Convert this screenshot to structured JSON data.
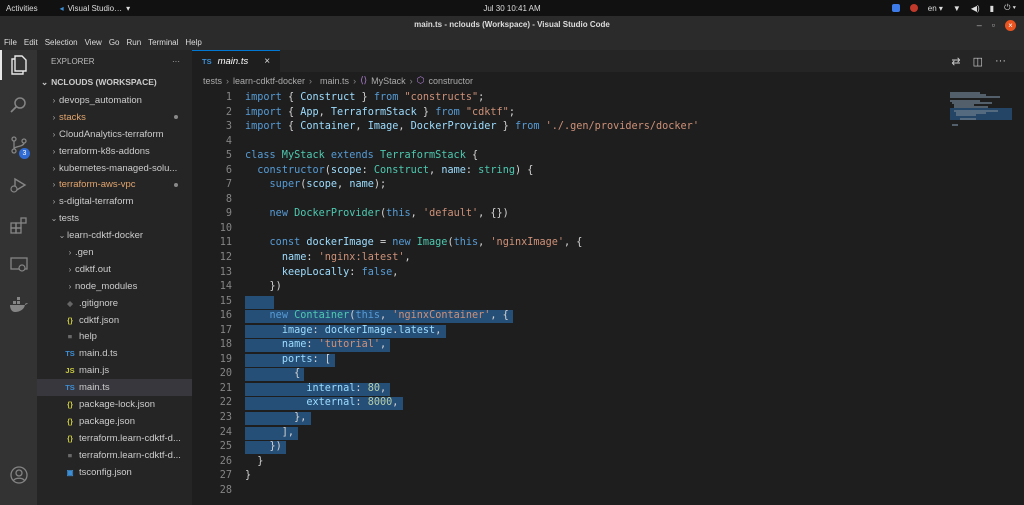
{
  "system_bar": {
    "activities": "Activities",
    "app_name": "Visual Studio…",
    "clock": "Jul 30  10:41 AM",
    "lang": "en"
  },
  "window": {
    "title": "main.ts - nclouds (Workspace) - Visual Studio Code"
  },
  "menu": {
    "items": [
      "File",
      "Edit",
      "Selection",
      "View",
      "Go",
      "Run",
      "Terminal",
      "Help"
    ]
  },
  "activity_bar": {
    "scm_badge": "3"
  },
  "sidebar": {
    "title": "EXPLORER",
    "more": "···",
    "workspace": "NCLOUDS (WORKSPACE)",
    "items": [
      {
        "label": "devops_automation",
        "chevron": "›",
        "icon": "",
        "indent": 12,
        "color": "#cccccc",
        "modified": false
      },
      {
        "label": "stacks",
        "chevron": "›",
        "icon": "",
        "indent": 12,
        "color": "#e2a56d",
        "modified": true
      },
      {
        "label": "CloudAnalytics-terraform",
        "chevron": "›",
        "icon": "",
        "indent": 12,
        "color": "#cccccc",
        "modified": false
      },
      {
        "label": "terraform-k8s-addons",
        "chevron": "›",
        "icon": "",
        "indent": 12,
        "color": "#cccccc",
        "modified": false
      },
      {
        "label": "kubernetes-managed-solu...",
        "chevron": "›",
        "icon": "",
        "indent": 12,
        "color": "#cccccc",
        "modified": false
      },
      {
        "label": "terraform-aws-vpc",
        "chevron": "›",
        "icon": "",
        "indent": 12,
        "color": "#e2a56d",
        "modified": true
      },
      {
        "label": "s-digital-terraform",
        "chevron": "›",
        "icon": "",
        "indent": 12,
        "color": "#cccccc",
        "modified": false
      },
      {
        "label": "tests",
        "chevron": "⌄",
        "icon": "",
        "indent": 12,
        "color": "#cccccc",
        "modified": false
      },
      {
        "label": "learn-cdktf-docker",
        "chevron": "⌄",
        "icon": "",
        "indent": 20,
        "color": "#cccccc",
        "modified": false
      },
      {
        "label": ".gen",
        "chevron": "›",
        "icon": "",
        "indent": 28,
        "color": "#cccccc",
        "modified": false
      },
      {
        "label": "cdktf.out",
        "chevron": "›",
        "icon": "",
        "indent": 28,
        "color": "#cccccc",
        "modified": false
      },
      {
        "label": "node_modules",
        "chevron": "›",
        "icon": "",
        "indent": 28,
        "color": "#cccccc",
        "modified": false
      },
      {
        "label": ".gitignore",
        "chevron": "",
        "icon": "◆",
        "icon_color": "#666666",
        "indent": 28,
        "color": "#cccccc",
        "modified": false
      },
      {
        "label": "cdktf.json",
        "chevron": "",
        "icon": "{}",
        "icon_color": "#cbcb41",
        "indent": 28,
        "color": "#cccccc",
        "modified": false
      },
      {
        "label": "help",
        "chevron": "",
        "icon": "≡",
        "icon_color": "#aaaaaa",
        "indent": 28,
        "color": "#cccccc",
        "modified": false
      },
      {
        "label": "main.d.ts",
        "chevron": "",
        "icon": "TS",
        "icon_color": "#3c8fd6",
        "indent": 28,
        "color": "#cccccc",
        "modified": false
      },
      {
        "label": "main.js",
        "chevron": "",
        "icon": "JS",
        "icon_color": "#cbcb41",
        "indent": 28,
        "color": "#cccccc",
        "modified": false
      },
      {
        "label": "main.ts",
        "chevron": "",
        "icon": "TS",
        "icon_color": "#3c8fd6",
        "indent": 28,
        "color": "#cccccc",
        "modified": false,
        "selected": true
      },
      {
        "label": "package-lock.json",
        "chevron": "",
        "icon": "{}",
        "icon_color": "#cbcb41",
        "indent": 28,
        "color": "#cccccc",
        "modified": false
      },
      {
        "label": "package.json",
        "chevron": "",
        "icon": "{}",
        "icon_color": "#cbcb41",
        "indent": 28,
        "color": "#cccccc",
        "modified": false
      },
      {
        "label": "terraform.learn-cdktf-d...",
        "chevron": "",
        "icon": "{}",
        "icon_color": "#cbcb41",
        "indent": 28,
        "color": "#cccccc",
        "modified": false
      },
      {
        "label": "terraform.learn-cdktf-d...",
        "chevron": "",
        "icon": "≡",
        "icon_color": "#aaaaaa",
        "indent": 28,
        "color": "#cccccc",
        "modified": false
      },
      {
        "label": "tsconfig.json",
        "chevron": "",
        "icon": "▣",
        "icon_color": "#3c8fd6",
        "indent": 28,
        "color": "#cccccc",
        "modified": false
      }
    ]
  },
  "editor": {
    "tab": {
      "icon": "TS",
      "label": "main.ts",
      "close": "×"
    },
    "breadcrumb": [
      "tests",
      "learn-cdktf-docker",
      "main.ts",
      "MyStack",
      "constructor"
    ],
    "breadcrumb_icons": {
      "main.ts": "TS",
      "MyStack": "⟨⟩",
      "constructor": "⬡"
    },
    "lines": [
      {
        "n": 1,
        "code": [
          [
            "k",
            "import"
          ],
          [
            "p",
            " { "
          ],
          [
            "v",
            "Construct"
          ],
          [
            "p",
            " } "
          ],
          [
            "k",
            "from"
          ],
          [
            "s",
            " \"constructs\""
          ],
          [
            "p",
            ";"
          ]
        ]
      },
      {
        "n": 2,
        "code": [
          [
            "k",
            "import"
          ],
          [
            "p",
            " { "
          ],
          [
            "v",
            "App"
          ],
          [
            "p",
            ", "
          ],
          [
            "v",
            "TerraformStack"
          ],
          [
            "p",
            " } "
          ],
          [
            "k",
            "from"
          ],
          [
            "s",
            " \"cdktf\""
          ],
          [
            "p",
            ";"
          ]
        ]
      },
      {
        "n": 3,
        "code": [
          [
            "k",
            "import"
          ],
          [
            "p",
            " { "
          ],
          [
            "v",
            "Container"
          ],
          [
            "p",
            ", "
          ],
          [
            "v",
            "Image"
          ],
          [
            "p",
            ", "
          ],
          [
            "v",
            "DockerProvider"
          ],
          [
            "p",
            " } "
          ],
          [
            "k",
            "from"
          ],
          [
            "s",
            " './.gen/providers/docker'"
          ]
        ]
      },
      {
        "n": 4,
        "code": []
      },
      {
        "n": 5,
        "code": [
          [
            "k",
            "class"
          ],
          [
            "t",
            " MyStack"
          ],
          [
            "k",
            " extends"
          ],
          [
            "t",
            " TerraformStack"
          ],
          [
            "p",
            " {"
          ]
        ]
      },
      {
        "n": 6,
        "code": [
          [
            "p",
            "  "
          ],
          [
            "k",
            "constructor"
          ],
          [
            "p",
            "("
          ],
          [
            "v",
            "scope"
          ],
          [
            "p",
            ": "
          ],
          [
            "t",
            "Construct"
          ],
          [
            "p",
            ", "
          ],
          [
            "v",
            "name"
          ],
          [
            "p",
            ": "
          ],
          [
            "t",
            "string"
          ],
          [
            "p",
            ") {"
          ]
        ]
      },
      {
        "n": 7,
        "code": [
          [
            "p",
            "    "
          ],
          [
            "k",
            "super"
          ],
          [
            "p",
            "("
          ],
          [
            "v",
            "scope"
          ],
          [
            "p",
            ", "
          ],
          [
            "v",
            "name"
          ],
          [
            "p",
            ");"
          ]
        ]
      },
      {
        "n": 8,
        "code": []
      },
      {
        "n": 9,
        "code": [
          [
            "p",
            "    "
          ],
          [
            "k",
            "new"
          ],
          [
            "t",
            " DockerProvider"
          ],
          [
            "p",
            "("
          ],
          [
            "k",
            "this"
          ],
          [
            "p",
            ", "
          ],
          [
            "s",
            "'default'"
          ],
          [
            "p",
            ", {})"
          ]
        ]
      },
      {
        "n": 10,
        "code": []
      },
      {
        "n": 11,
        "code": [
          [
            "p",
            "    "
          ],
          [
            "k",
            "const"
          ],
          [
            "v",
            " dockerImage"
          ],
          [
            "p",
            " = "
          ],
          [
            "k",
            "new"
          ],
          [
            "t",
            " Image"
          ],
          [
            "p",
            "("
          ],
          [
            "k",
            "this"
          ],
          [
            "p",
            ", "
          ],
          [
            "s",
            "'nginxImage'"
          ],
          [
            "p",
            ", {"
          ]
        ]
      },
      {
        "n": 12,
        "code": [
          [
            "p",
            "      "
          ],
          [
            "v",
            "name"
          ],
          [
            "p",
            ": "
          ],
          [
            "s",
            "'nginx:latest'"
          ],
          [
            "p",
            ","
          ]
        ]
      },
      {
        "n": 13,
        "code": [
          [
            "p",
            "      "
          ],
          [
            "v",
            "keepLocally"
          ],
          [
            "p",
            ": "
          ],
          [
            "k",
            "false"
          ],
          [
            "p",
            ","
          ]
        ]
      },
      {
        "n": 14,
        "code": [
          [
            "p",
            "    })"
          ]
        ]
      },
      {
        "n": 15,
        "code": [
          [
            "p",
            "    "
          ]
        ],
        "sel": true
      },
      {
        "n": 16,
        "code": [
          [
            "p",
            "    "
          ],
          [
            "k",
            "new"
          ],
          [
            "t",
            " Container"
          ],
          [
            "p",
            "("
          ],
          [
            "k",
            "this"
          ],
          [
            "p",
            ", "
          ],
          [
            "s",
            "'nginxContainer'"
          ],
          [
            "p",
            ", {"
          ]
        ],
        "sel": true
      },
      {
        "n": 17,
        "code": [
          [
            "p",
            "      "
          ],
          [
            "v",
            "image"
          ],
          [
            "p",
            ": "
          ],
          [
            "v",
            "dockerImage"
          ],
          [
            "p",
            "."
          ],
          [
            "v",
            "latest"
          ],
          [
            "p",
            ","
          ]
        ],
        "sel": true
      },
      {
        "n": 18,
        "code": [
          [
            "p",
            "      "
          ],
          [
            "v",
            "name"
          ],
          [
            "p",
            ": "
          ],
          [
            "s",
            "'tutorial'"
          ],
          [
            "p",
            ","
          ]
        ],
        "sel": true
      },
      {
        "n": 19,
        "code": [
          [
            "p",
            "      "
          ],
          [
            "v",
            "ports"
          ],
          [
            "p",
            ": ["
          ]
        ],
        "sel": true
      },
      {
        "n": 20,
        "code": [
          [
            "p",
            "        {"
          ]
        ],
        "sel": true
      },
      {
        "n": 21,
        "code": [
          [
            "p",
            "          "
          ],
          [
            "v",
            "internal"
          ],
          [
            "p",
            ": "
          ],
          [
            "n",
            "80"
          ],
          [
            "p",
            ","
          ]
        ],
        "sel": true
      },
      {
        "n": 22,
        "code": [
          [
            "p",
            "          "
          ],
          [
            "v",
            "external"
          ],
          [
            "p",
            ": "
          ],
          [
            "n",
            "8000"
          ],
          [
            "p",
            ","
          ]
        ],
        "sel": true
      },
      {
        "n": 23,
        "code": [
          [
            "p",
            "        },"
          ]
        ],
        "sel": true
      },
      {
        "n": 24,
        "code": [
          [
            "p",
            "      ],"
          ]
        ],
        "sel": true
      },
      {
        "n": 25,
        "code": [
          [
            "p",
            "    })"
          ]
        ],
        "sel": true
      },
      {
        "n": 26,
        "code": [
          [
            "p",
            "  }"
          ]
        ]
      },
      {
        "n": 27,
        "code": [
          [
            "p",
            "}"
          ]
        ]
      },
      {
        "n": 28,
        "code": []
      }
    ]
  }
}
